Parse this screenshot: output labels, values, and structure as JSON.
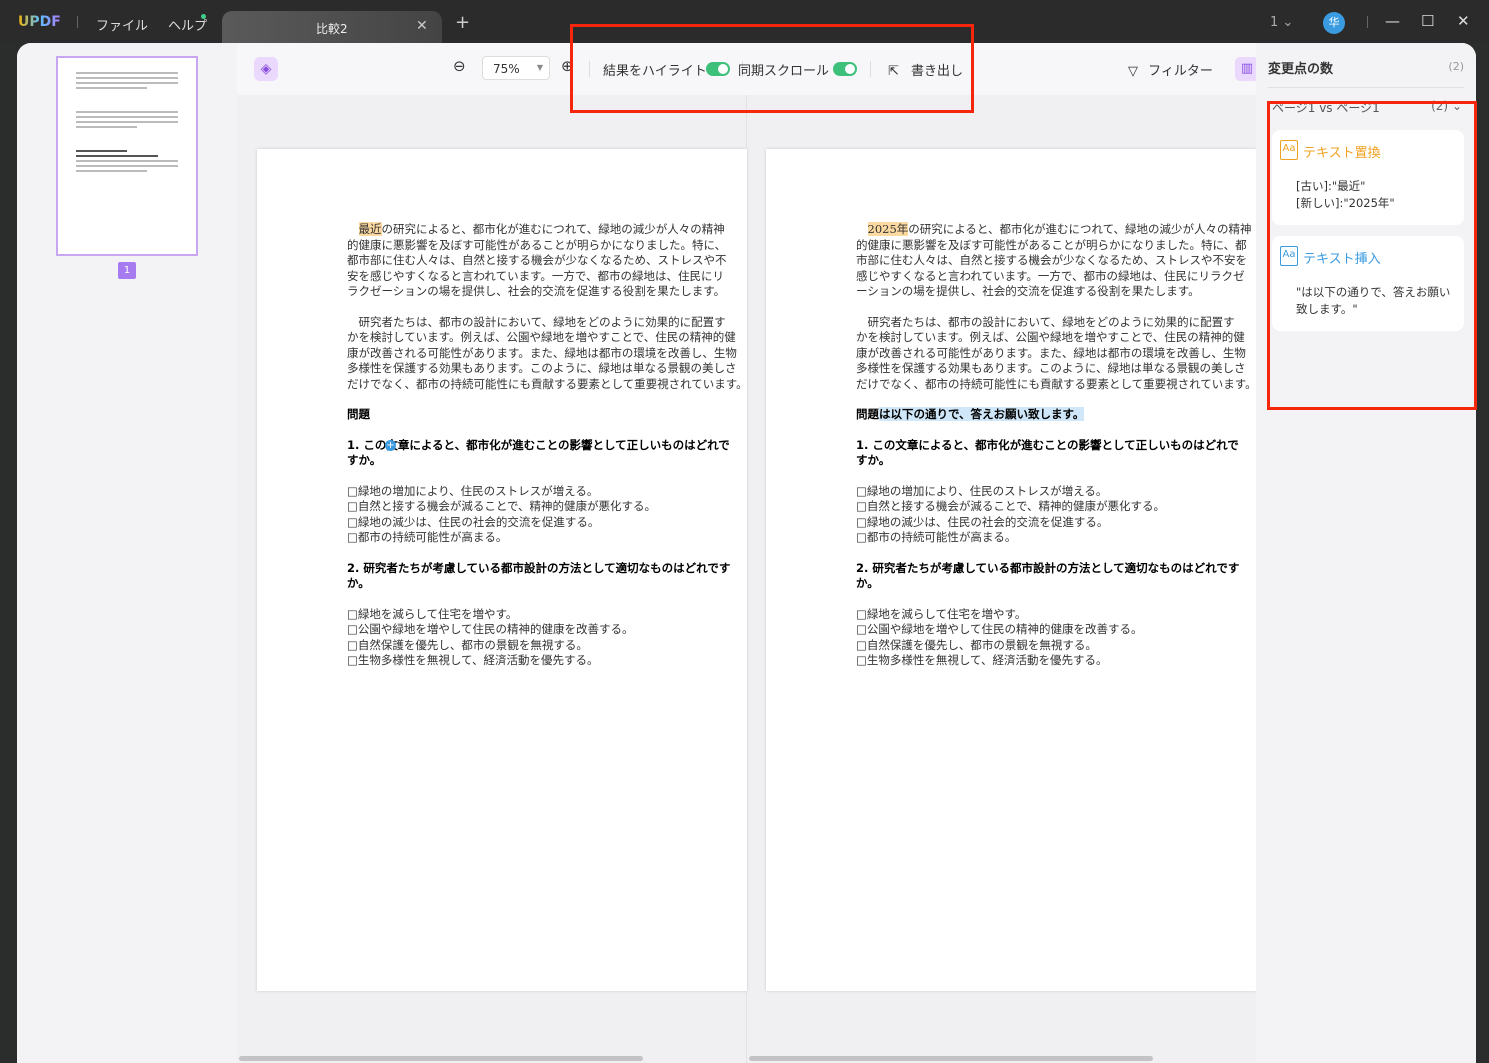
{
  "app": {
    "logo": "UPDF",
    "menu": [
      "ファイル",
      "ヘルプ"
    ],
    "tab_title": "比較2",
    "page_indicator": "1",
    "avatar_initial": "华"
  },
  "toolbar": {
    "zoom": "75%",
    "highlight_label": "結果をハイライト",
    "highlight_on": true,
    "sync_scroll_label": "同期スクロール",
    "sync_scroll_on": true,
    "export_label": "書き出し",
    "filter_label": "フィルター"
  },
  "thumbnails": {
    "page_number": "1"
  },
  "left_doc": {
    "para1": [
      "最近",
      "の研究によると、都市化が進むにつれて、緑地の減少が人々の精神",
      "的健康に悪影響を及ぼす可能性があることが明らかになりました。特に、",
      "都市部に住む人々は、自然と接する機会が少なくなるため、ストレスや不",
      "安を感じやすくなると言われています。一方で、都市の緑地は、住民にリ",
      "ラクゼーションの場を提供し、社会的交流を促進する役割を果たします。"
    ],
    "heading": "問題"
  },
  "right_doc": {
    "para1": [
      "2025年",
      "の研究によると、都市化が進むにつれて、緑地の減少が人々の精神",
      "的健康に悪影響を及ぼす可能性があることが明らかになりました。特に、都",
      "市部に住む人々は、自然と接する機会が少なくなるため、ストレスや不安を",
      "感じやすくなると言われています。一方で、都市の緑地は、住民にリラクゼ",
      "ーションの場を提供し、社会的交流を促進する役割を果たします。"
    ],
    "heading": "問題",
    "heading_insert": "は以下の通りで、答えお願い致します。"
  },
  "common": {
    "para2": [
      "　研究者たちは、都市の設計において、緑地をどのように効果的に配置す",
      "かを検討しています。例えば、公園や緑地を増やすことで、住民の精神的健",
      "康が改善される可能性があります。また、緑地は都市の環境を改善し、生物",
      "多様性を保護する効果もあります。このように、緑地は単なる景観の美しさ",
      "だけでなく、都市の持続可能性にも貢献する要素として重要視されています。"
    ],
    "q1": [
      "1.  この文章によると、都市化が進むことの影響として正しいものはどれで",
      "すか。"
    ],
    "q1_options": [
      "□緑地の増加により、住民のストレスが増える。",
      "□自然と接する機会が減ることで、精神的健康が悪化する。",
      "□緑地の減少は、住民の社会的交流を促進する。",
      "□都市の持続可能性が高まる。"
    ],
    "q2": [
      "2.  研究者たちが考慮している都市設計の方法として適切なものはどれです",
      "か。"
    ],
    "q2_options": [
      "□緑地を減らして住宅を増やす。",
      "□公園や緑地を増やして住民の精神的健康を改善する。",
      "□自然保護を優先し、都市の景観を無視する。",
      "□生物多様性を無視して、経済活動を優先する。"
    ]
  },
  "changes": {
    "title": "変更点の数",
    "count": "(2)",
    "section": "ページ1 vs ページ1",
    "section_count": "(2)",
    "items": [
      {
        "type": "テキスト置換",
        "color": "#f0a020",
        "lines": [
          "[古い]:\"最近\"",
          "[新しい]:\"2025年\""
        ]
      },
      {
        "type": "テキスト挿入",
        "color": "#3a9be0",
        "lines": [
          "\"は以下の通りで、答えお願い",
          "致します。\""
        ]
      }
    ]
  },
  "colors": {
    "accent": "#a77bf0",
    "toggle": "#3cc07a",
    "annotation": "#f5260b"
  }
}
